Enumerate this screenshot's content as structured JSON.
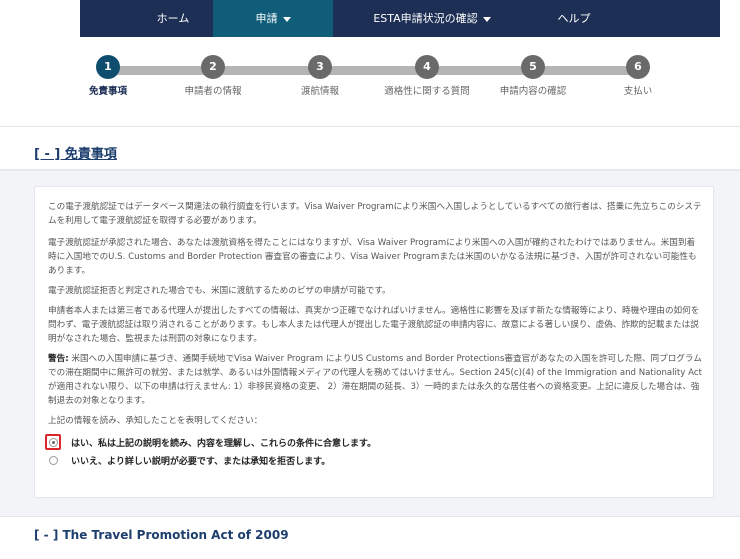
{
  "nav": {
    "items": [
      {
        "label": "ホーム",
        "has_caret": false
      },
      {
        "label": "申請",
        "has_caret": true
      },
      {
        "label": "ESTA申請状況の確認",
        "has_caret": true
      },
      {
        "label": "ヘルプ",
        "has_caret": false
      }
    ],
    "active_index": 1
  },
  "stepper": {
    "active_index": 0,
    "steps": [
      {
        "number": "1",
        "label": "免責事項"
      },
      {
        "number": "2",
        "label": "申請者の情報"
      },
      {
        "number": "3",
        "label": "渡航情報"
      },
      {
        "number": "4",
        "label": "適格性に関する質問"
      },
      {
        "number": "5",
        "label": "申請内容の確認"
      },
      {
        "number": "6",
        "label": "支払い"
      }
    ]
  },
  "disclaimer": {
    "title": "[ - ] 免責事項",
    "p1": "この電子渡航認証ではデータベース関連法の執行調査を行います。Visa Waiver Programにより米国へ入国しようとしているすべての旅行者は、搭乗に先立ちこのシステムを利用して電子渡航認証を取得する必要があります。",
    "p2": "電子渡航認証が承認された場合、あなたは渡航資格を得たことにはなりますが、Visa Waiver Programにより米国への入国が確約されたわけではありません。米国到着時に入国地でのU.S. Customs and Border Protection 審査官の審査により、Visa Waiver Programまたは米国のいかなる法規に基づき、入国が許可されない可能性もあります。",
    "p3": "電子渡航認証拒否と判定された場合でも、米国に渡航するためのビザの申請が可能です。",
    "p4": "申請者本人または第三者である代理人が提出したすべての情報は、真実かつ正確でなければいけません。適格性に影響を及ぼす新たな情報等により、時機や理由の如何を問わず、電子渡航認証は取り消されることがあります。もし本人または代理人が提出した電子渡航認証の申請内容に、故意による著しい誤り、虚偽、詐欺的記載または説明がなされた場合、監視または刑罰の対象になります。",
    "warning_label": "警告:",
    "p5": " 米国への入国申請に基づき、通関手続地でVisa Waiver Program によりUS Customs and Border Protections審査官があなたの入国を許可した際、同プログラムでの滞在期間中に無許可の就労、または就学、あるいは外国情報メディアの代理人を務めてはいけません。Section 245(c)(4) of the Immigration and Nationality Actが適用されない限り、以下の申請は行えません: 1）非移民資格の変更、 2）滞在期間の延長、3）一時的または永久的な居住者への資格変更。上記に違反した場合は、強制退去の対象となります。",
    "p6": "上記の情報を読み、承知したことを表明してください：",
    "option_yes": "はい、私は上記の説明を読み、内容を理解し、これらの条件に合意します。",
    "option_no": "いいえ、より詳しい説明が必要です、または承知を拒否します。",
    "selected": "yes"
  },
  "travel_promotion": {
    "title": "[ - ] The Travel Promotion Act of 2009"
  }
}
